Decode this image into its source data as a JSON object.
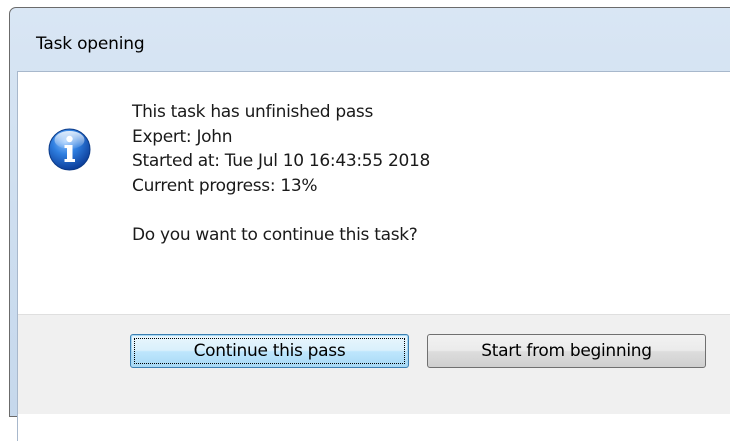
{
  "dialog": {
    "title": "Task opening",
    "icon": "info-icon",
    "message_lines": [
      "This task has unfinished pass",
      "Expert: John",
      "Started at: Tue Jul 10 16:43:55 2018",
      "Current progress: 13%"
    ],
    "question": "Do you want to continue this task?",
    "buttons": {
      "continue_label": "Continue this pass",
      "start_label": "Start from beginning"
    }
  }
}
